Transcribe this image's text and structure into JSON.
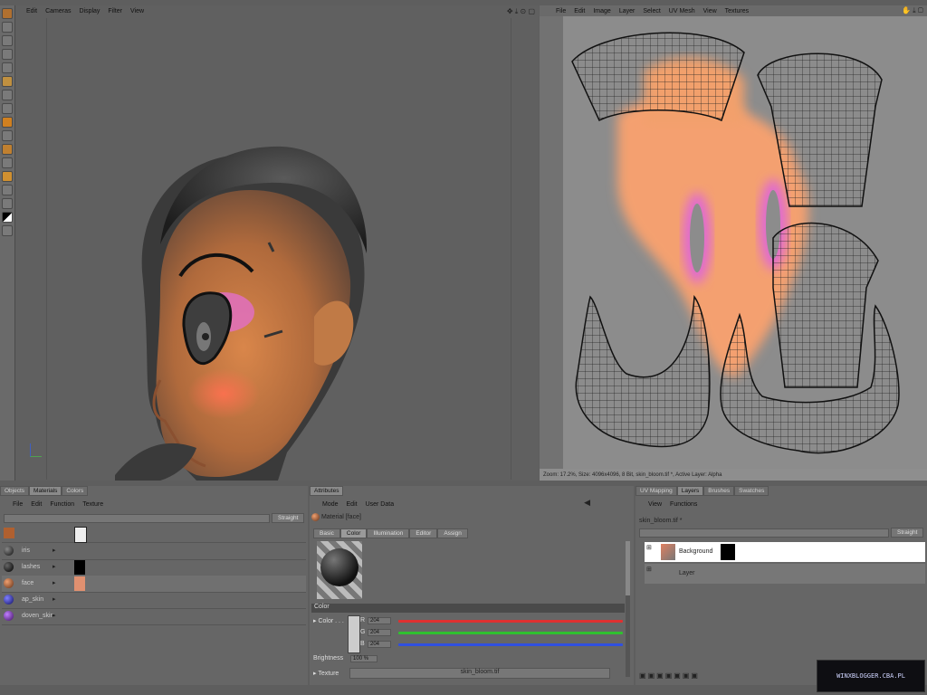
{
  "viewport": {
    "menu": [
      "Edit",
      "Cameras",
      "Display",
      "Filter",
      "View"
    ]
  },
  "bodypaint": {
    "menu": [
      "File",
      "Edit",
      "Image",
      "Layer",
      "Select",
      "UV Mesh",
      "View",
      "Textures"
    ],
    "status": "Zoom: 17.2%, Size: 4096x4096, 8 Bit, skin_bloom.tif *, Active Layer: Alpha"
  },
  "materials_panel": {
    "tabs": [
      "Objects",
      "Materials",
      "Colors"
    ],
    "active_tab": "Materials",
    "menu": [
      "File",
      "Edit",
      "Function",
      "Texture"
    ],
    "mode_dropdown": "Straight",
    "items": [
      {
        "name": "iris"
      },
      {
        "name": "lashes"
      },
      {
        "name": "face"
      },
      {
        "name": "ap_skin"
      },
      {
        "name": "doven_skin"
      }
    ]
  },
  "attributes_panel": {
    "tab": "Attributes",
    "menu": [
      "Mode",
      "Edit",
      "User Data"
    ],
    "material_title": "Material [face]",
    "subtabs": [
      "Basic",
      "Color",
      "Illumination",
      "Editor",
      "Assign"
    ],
    "active_subtab": "Color",
    "section": "Color",
    "color_label": "Color",
    "rgb": [
      {
        "channel": "R",
        "value": "204",
        "color": "#e03030"
      },
      {
        "channel": "G",
        "value": "204",
        "color": "#30c030"
      },
      {
        "channel": "B",
        "value": "204",
        "color": "#3050e0"
      }
    ],
    "brightness_label": "Brightness",
    "brightness_value": "100 %",
    "texture_label": "Texture",
    "texture_file": "skin_bloom.tif"
  },
  "layers_panel": {
    "tabs": [
      "UV Mapping",
      "Layers",
      "Brushes",
      "Swatches"
    ],
    "active_tab": "Layers",
    "menu": [
      "View",
      "Functions"
    ],
    "file": "skin_bloom.tif *",
    "mode_dropdown": "Straight",
    "layers": [
      {
        "name": "Background"
      },
      {
        "name": "Layer"
      }
    ]
  },
  "watermark": "WINXBLOGGER.CBA.PL"
}
